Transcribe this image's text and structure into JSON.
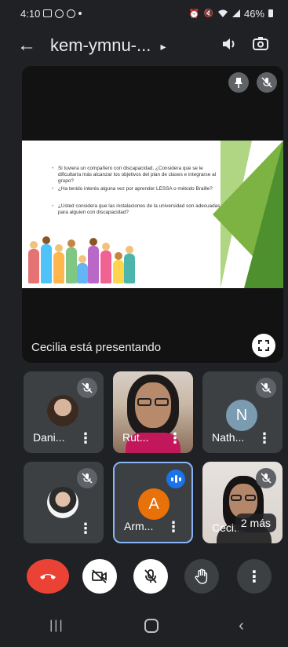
{
  "status": {
    "time": "4:10",
    "battery": "46%"
  },
  "header": {
    "meeting_code": "kem-ymnu-...",
    "more_glyph": "▸"
  },
  "presentation": {
    "caption": "Cecilia está presentando",
    "slide_questions": [
      "Si tuviera un compañero con discapacidad, ¿Considera que se le dificultaría más alcanzar los objetivos del plan de clases e integrarse al grupo?",
      "¿Ha tenido interés alguna vez por aprender LESSA o método Braille?",
      "¿Usted considera que las instalaciones de la universidad son adecuadas para alguien con discapacidad?"
    ]
  },
  "participants": [
    {
      "name": "Dani...",
      "muted": true
    },
    {
      "name": "Rut...",
      "muted": false
    },
    {
      "name": "Nath...",
      "muted": true,
      "initial": "N"
    },
    {
      "name": "",
      "muted": true
    },
    {
      "name": "Arm...",
      "muted": false,
      "initial": "A",
      "speaking": true
    },
    {
      "name": "Ceci...",
      "muted": true
    }
  ],
  "more_participants": "2 más",
  "colors": {
    "background": "#202124",
    "tile": "#3c4043",
    "end_call": "#ea4335",
    "accent_blue": "#1a73e8",
    "avatar_orange": "#e8710a",
    "avatar_slate": "#7b9bb1"
  }
}
